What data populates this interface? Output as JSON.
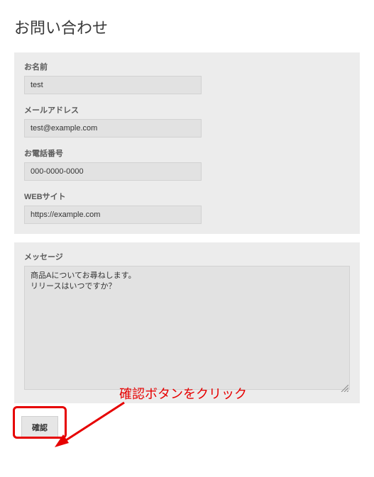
{
  "page": {
    "title": "お問い合わせ"
  },
  "form": {
    "name": {
      "label": "お名前",
      "value": "test"
    },
    "email": {
      "label": "メールアドレス",
      "value": "test@example.com"
    },
    "phone": {
      "label": "お電話番号",
      "value": "000-0000-0000"
    },
    "web": {
      "label": "WEBサイト",
      "value": "https://example.com"
    },
    "message": {
      "label": "メッセージ",
      "value": "商品Aについてお尋ねします。\nリリースはいつですか？"
    },
    "confirm_label": "確認"
  },
  "annotation": {
    "text": "確認ボタンをクリック",
    "color": "#e60000"
  }
}
